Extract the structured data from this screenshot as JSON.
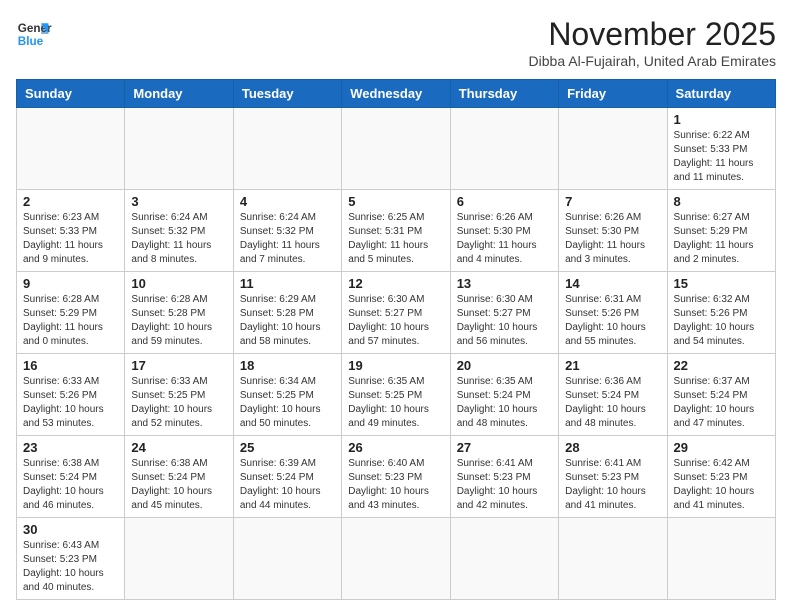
{
  "header": {
    "logo_general": "General",
    "logo_blue": "Blue",
    "month_title": "November 2025",
    "subtitle": "Dibba Al-Fujairah, United Arab Emirates"
  },
  "weekdays": [
    "Sunday",
    "Monday",
    "Tuesday",
    "Wednesday",
    "Thursday",
    "Friday",
    "Saturday"
  ],
  "days": [
    {
      "num": "",
      "info": ""
    },
    {
      "num": "",
      "info": ""
    },
    {
      "num": "",
      "info": ""
    },
    {
      "num": "",
      "info": ""
    },
    {
      "num": "",
      "info": ""
    },
    {
      "num": "",
      "info": ""
    },
    {
      "num": "1",
      "info": "Sunrise: 6:22 AM\nSunset: 5:33 PM\nDaylight: 11 hours and 11 minutes."
    },
    {
      "num": "2",
      "info": "Sunrise: 6:23 AM\nSunset: 5:33 PM\nDaylight: 11 hours and 9 minutes."
    },
    {
      "num": "3",
      "info": "Sunrise: 6:24 AM\nSunset: 5:32 PM\nDaylight: 11 hours and 8 minutes."
    },
    {
      "num": "4",
      "info": "Sunrise: 6:24 AM\nSunset: 5:32 PM\nDaylight: 11 hours and 7 minutes."
    },
    {
      "num": "5",
      "info": "Sunrise: 6:25 AM\nSunset: 5:31 PM\nDaylight: 11 hours and 5 minutes."
    },
    {
      "num": "6",
      "info": "Sunrise: 6:26 AM\nSunset: 5:30 PM\nDaylight: 11 hours and 4 minutes."
    },
    {
      "num": "7",
      "info": "Sunrise: 6:26 AM\nSunset: 5:30 PM\nDaylight: 11 hours and 3 minutes."
    },
    {
      "num": "8",
      "info": "Sunrise: 6:27 AM\nSunset: 5:29 PM\nDaylight: 11 hours and 2 minutes."
    },
    {
      "num": "9",
      "info": "Sunrise: 6:28 AM\nSunset: 5:29 PM\nDaylight: 11 hours and 0 minutes."
    },
    {
      "num": "10",
      "info": "Sunrise: 6:28 AM\nSunset: 5:28 PM\nDaylight: 10 hours and 59 minutes."
    },
    {
      "num": "11",
      "info": "Sunrise: 6:29 AM\nSunset: 5:28 PM\nDaylight: 10 hours and 58 minutes."
    },
    {
      "num": "12",
      "info": "Sunrise: 6:30 AM\nSunset: 5:27 PM\nDaylight: 10 hours and 57 minutes."
    },
    {
      "num": "13",
      "info": "Sunrise: 6:30 AM\nSunset: 5:27 PM\nDaylight: 10 hours and 56 minutes."
    },
    {
      "num": "14",
      "info": "Sunrise: 6:31 AM\nSunset: 5:26 PM\nDaylight: 10 hours and 55 minutes."
    },
    {
      "num": "15",
      "info": "Sunrise: 6:32 AM\nSunset: 5:26 PM\nDaylight: 10 hours and 54 minutes."
    },
    {
      "num": "16",
      "info": "Sunrise: 6:33 AM\nSunset: 5:26 PM\nDaylight: 10 hours and 53 minutes."
    },
    {
      "num": "17",
      "info": "Sunrise: 6:33 AM\nSunset: 5:25 PM\nDaylight: 10 hours and 52 minutes."
    },
    {
      "num": "18",
      "info": "Sunrise: 6:34 AM\nSunset: 5:25 PM\nDaylight: 10 hours and 50 minutes."
    },
    {
      "num": "19",
      "info": "Sunrise: 6:35 AM\nSunset: 5:25 PM\nDaylight: 10 hours and 49 minutes."
    },
    {
      "num": "20",
      "info": "Sunrise: 6:35 AM\nSunset: 5:24 PM\nDaylight: 10 hours and 48 minutes."
    },
    {
      "num": "21",
      "info": "Sunrise: 6:36 AM\nSunset: 5:24 PM\nDaylight: 10 hours and 48 minutes."
    },
    {
      "num": "22",
      "info": "Sunrise: 6:37 AM\nSunset: 5:24 PM\nDaylight: 10 hours and 47 minutes."
    },
    {
      "num": "23",
      "info": "Sunrise: 6:38 AM\nSunset: 5:24 PM\nDaylight: 10 hours and 46 minutes."
    },
    {
      "num": "24",
      "info": "Sunrise: 6:38 AM\nSunset: 5:24 PM\nDaylight: 10 hours and 45 minutes."
    },
    {
      "num": "25",
      "info": "Sunrise: 6:39 AM\nSunset: 5:24 PM\nDaylight: 10 hours and 44 minutes."
    },
    {
      "num": "26",
      "info": "Sunrise: 6:40 AM\nSunset: 5:23 PM\nDaylight: 10 hours and 43 minutes."
    },
    {
      "num": "27",
      "info": "Sunrise: 6:41 AM\nSunset: 5:23 PM\nDaylight: 10 hours and 42 minutes."
    },
    {
      "num": "28",
      "info": "Sunrise: 6:41 AM\nSunset: 5:23 PM\nDaylight: 10 hours and 41 minutes."
    },
    {
      "num": "29",
      "info": "Sunrise: 6:42 AM\nSunset: 5:23 PM\nDaylight: 10 hours and 41 minutes."
    },
    {
      "num": "30",
      "info": "Sunrise: 6:43 AM\nSunset: 5:23 PM\nDaylight: 10 hours and 40 minutes."
    },
    {
      "num": "",
      "info": ""
    },
    {
      "num": "",
      "info": ""
    },
    {
      "num": "",
      "info": ""
    },
    {
      "num": "",
      "info": ""
    },
    {
      "num": "",
      "info": ""
    },
    {
      "num": "",
      "info": ""
    }
  ]
}
